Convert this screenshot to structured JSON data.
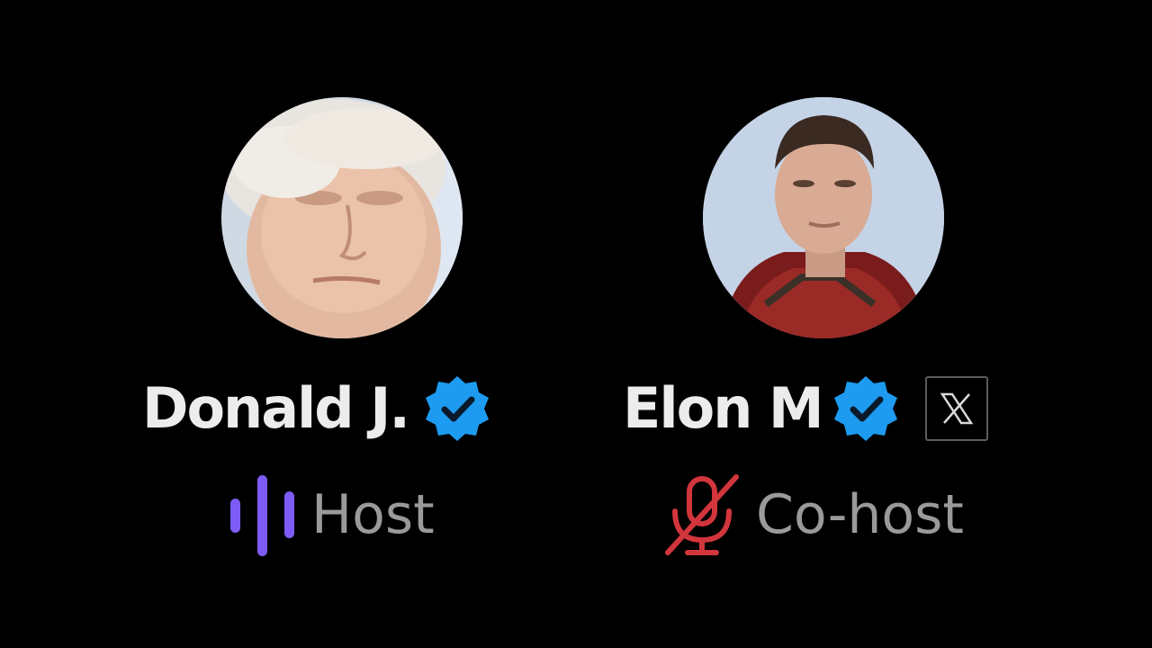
{
  "colors": {
    "background": "#000000",
    "name_text": "#ececec",
    "role_text": "#9a9a9a",
    "verified_badge": "#1d9bf0",
    "speaking_indicator": "#7d5cf5",
    "muted_indicator": "#d2353c"
  },
  "speakers": [
    {
      "name": "Donald J.",
      "verified": true,
      "role": "Host",
      "status_icon": "speaking-waveform-icon",
      "badge": null
    },
    {
      "name": "Elon M",
      "verified": true,
      "role": "Co-host",
      "status_icon": "muted-microphone-icon",
      "badge": "x-logo-icon"
    }
  ]
}
